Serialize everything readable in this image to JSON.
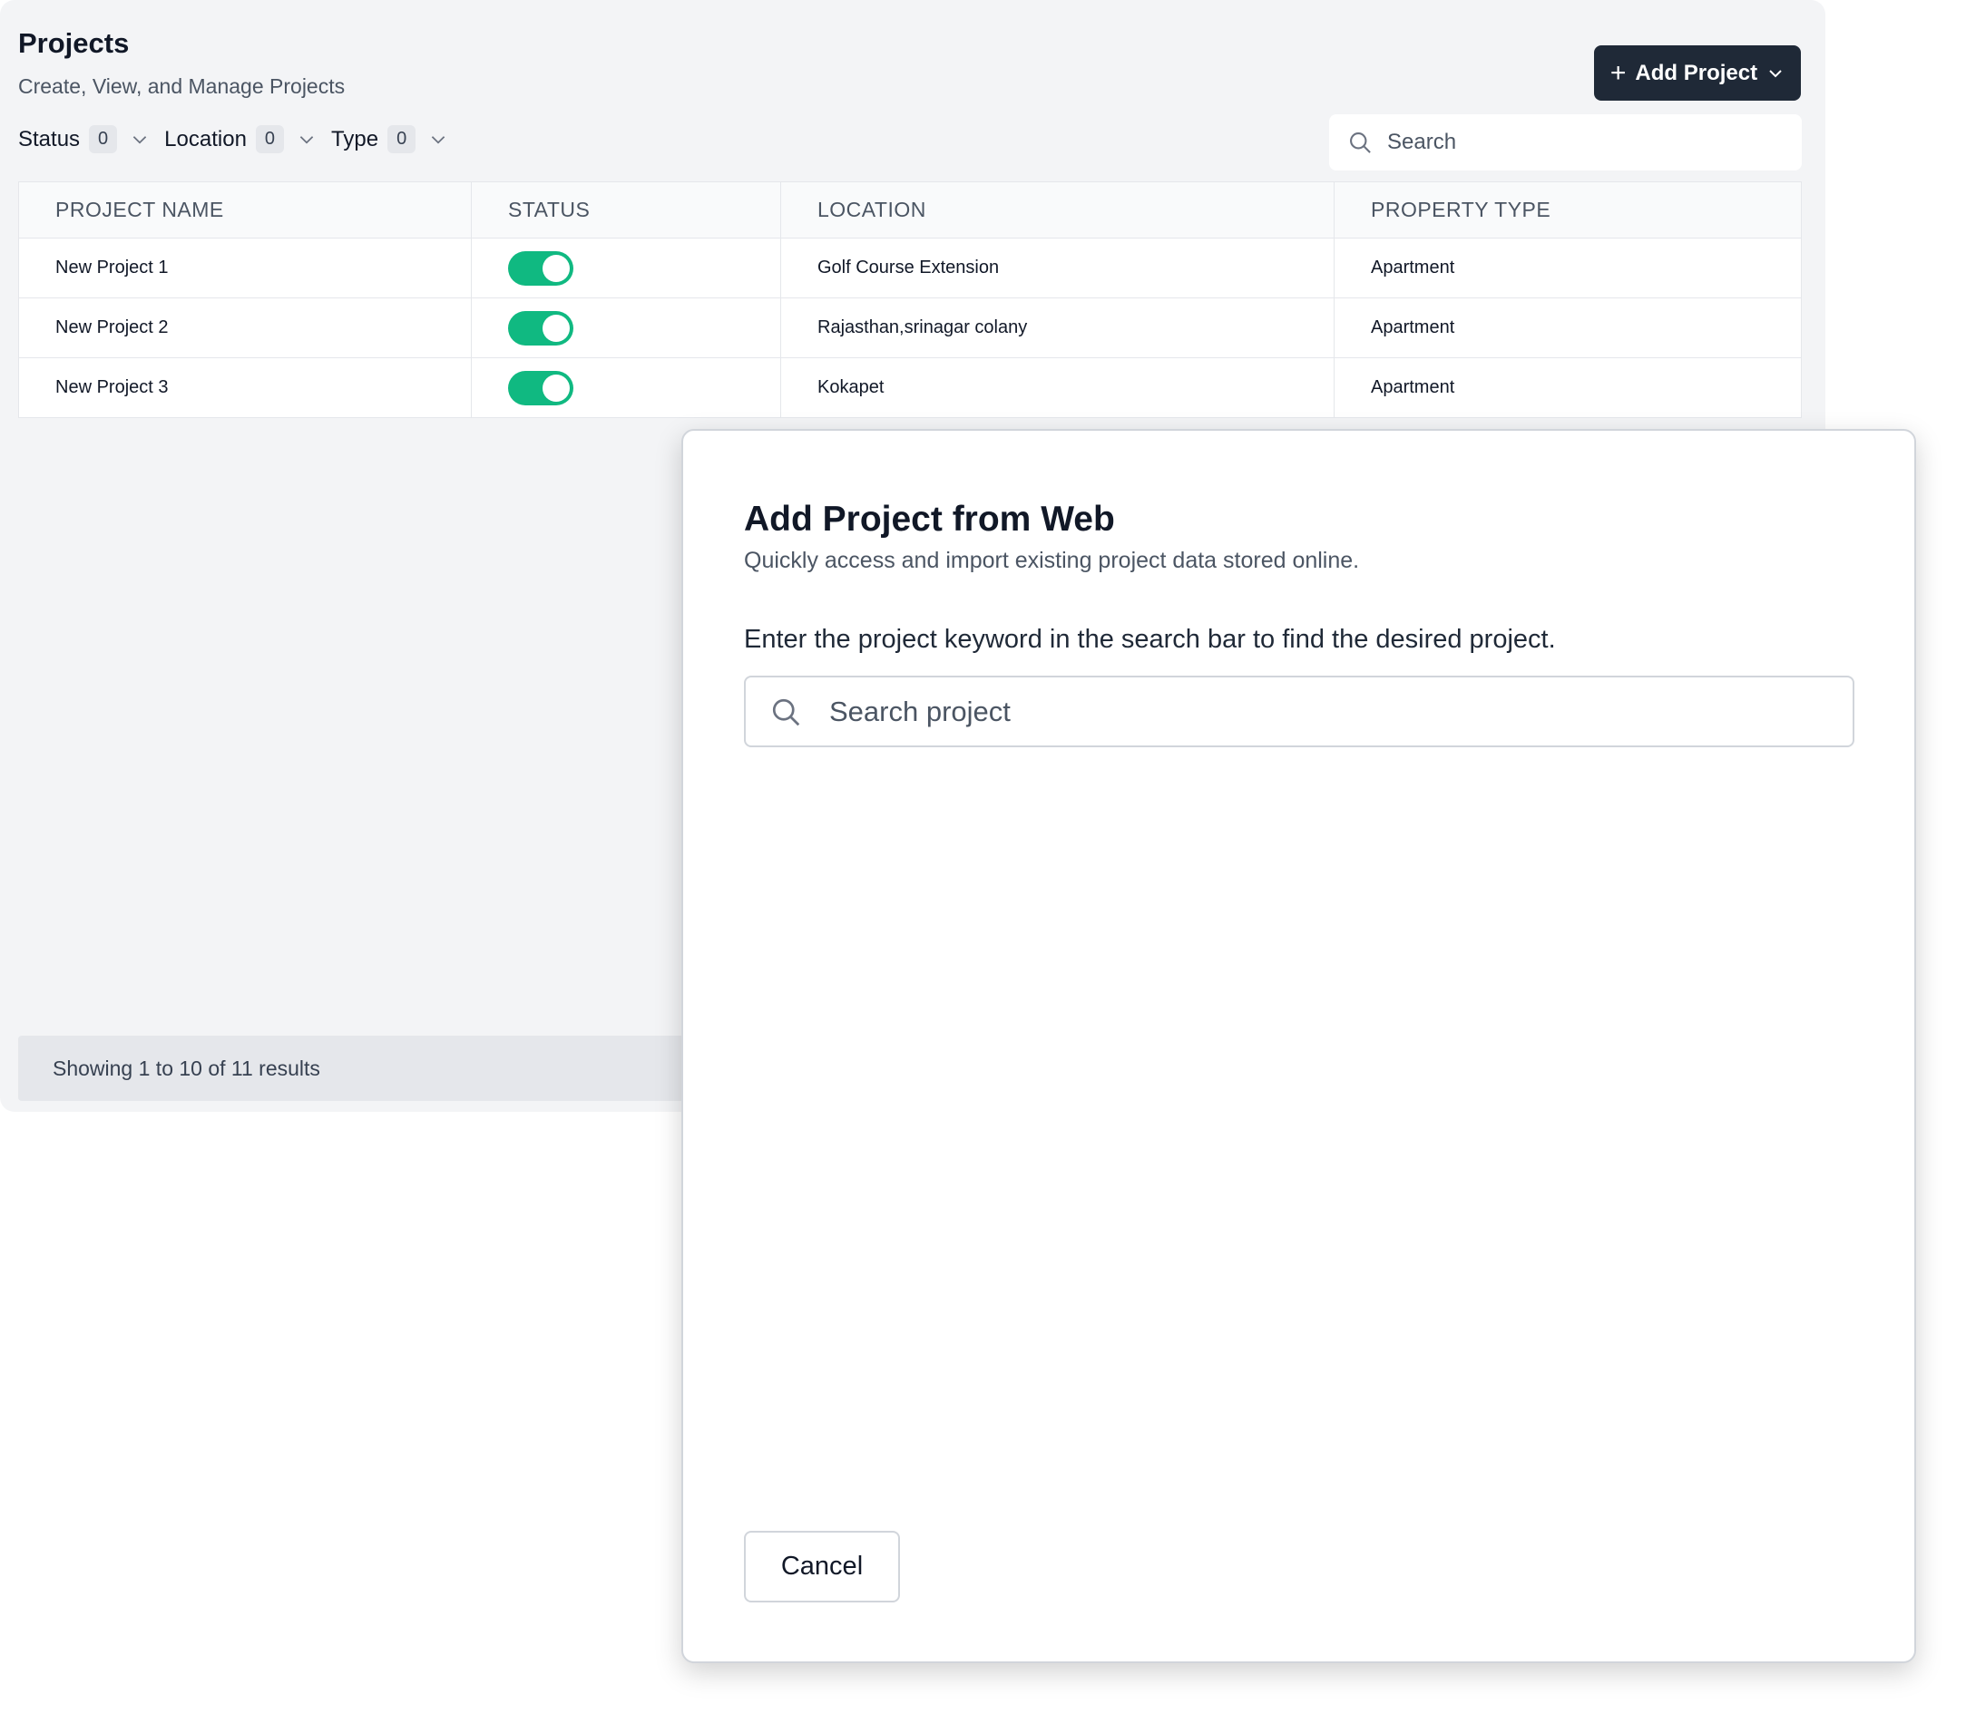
{
  "header": {
    "title": "Projects",
    "subtitle": "Create, View, and Manage Projects",
    "add_button_label": "Add Project"
  },
  "filters": [
    {
      "label": "Status",
      "count": "0"
    },
    {
      "label": "Location",
      "count": "0"
    },
    {
      "label": "Type",
      "count": "0"
    }
  ],
  "search": {
    "placeholder": "Search"
  },
  "table": {
    "columns": [
      "PROJECT NAME",
      "STATUS",
      "LOCATION",
      "PROPERTY TYPE"
    ],
    "rows": [
      {
        "name": "New Project 1",
        "status_on": true,
        "location": "Golf Course Extension",
        "type": "Apartment"
      },
      {
        "name": "New Project 2",
        "status_on": true,
        "location": "Rajasthan,srinagar colany",
        "type": "Apartment"
      },
      {
        "name": "New Project 3",
        "status_on": true,
        "location": "Kokapet",
        "type": "Apartment"
      }
    ]
  },
  "footer": {
    "text": "Showing 1 to 10 of 11 results"
  },
  "modal": {
    "title": "Add Project from Web",
    "subtitle": "Quickly access and import existing project data stored online.",
    "instruction": "Enter the project keyword in the search bar to find the desired project.",
    "search_placeholder": "Search project",
    "cancel_label": "Cancel"
  },
  "colors": {
    "primary_button": "#1f2937",
    "toggle_on": "#10b981",
    "panel_bg": "#f3f4f6"
  },
  "icons": [
    "plus-icon",
    "chevron-down-icon",
    "search-icon"
  ]
}
